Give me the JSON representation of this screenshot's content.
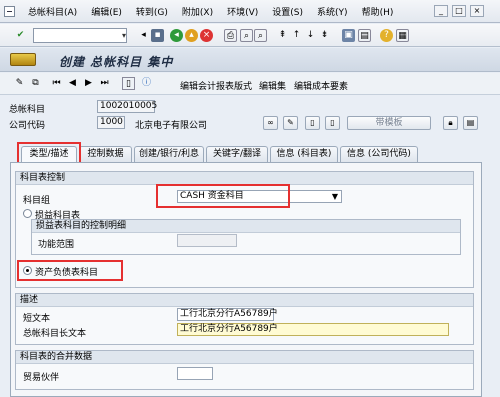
{
  "menu": {
    "items": [
      "总帐科目(A)",
      "编辑(E)",
      "转到(G)",
      "附加(X)",
      "环境(V)",
      "设置(S)",
      "系统(Y)",
      "帮助(H)"
    ]
  },
  "window_buttons": [
    "_",
    "□",
    "×"
  ],
  "title": "创建 总帐科目 集中",
  "app_toolbar": {
    "edit_coa_layout": "编辑会计报表版式",
    "edit_set": "编辑集",
    "edit_cost_element": "编辑成本要素"
  },
  "header": {
    "account_label": "总帐科目",
    "account_value": "1002010005",
    "company_label": "公司代码",
    "company_value": "1000",
    "company_name": "北京电子有限公司",
    "template_button": "带模板"
  },
  "tabs": [
    "类型/描述",
    "控制数据",
    "创建/银行/利息",
    "关键字/翻译",
    "信息 (科目表)",
    "信息 (公司代码)"
  ],
  "coa_control": {
    "title": "科目表控制",
    "account_group_label": "科目组",
    "account_group_value": "CASH 资金科目",
    "pl_label": "损益科目表",
    "pl_detail_title": "损益表科目的控制明细",
    "functional_area_label": "功能范围",
    "functional_area_value": "",
    "bs_label": "资产负债表科目"
  },
  "description": {
    "title": "描述",
    "short_text_label": "短文本",
    "short_text_value": "工行北京分行A56789户",
    "long_text_label": "总帐科目长文本",
    "long_text_value": "工行北京分行A56789户"
  },
  "consolidation": {
    "title": "科目表的合并数据",
    "trading_partner_label": "贸易伙伴",
    "trading_partner_value": ""
  },
  "colors": {
    "highlight": "#e53030",
    "panel": "#f4f6f9"
  }
}
